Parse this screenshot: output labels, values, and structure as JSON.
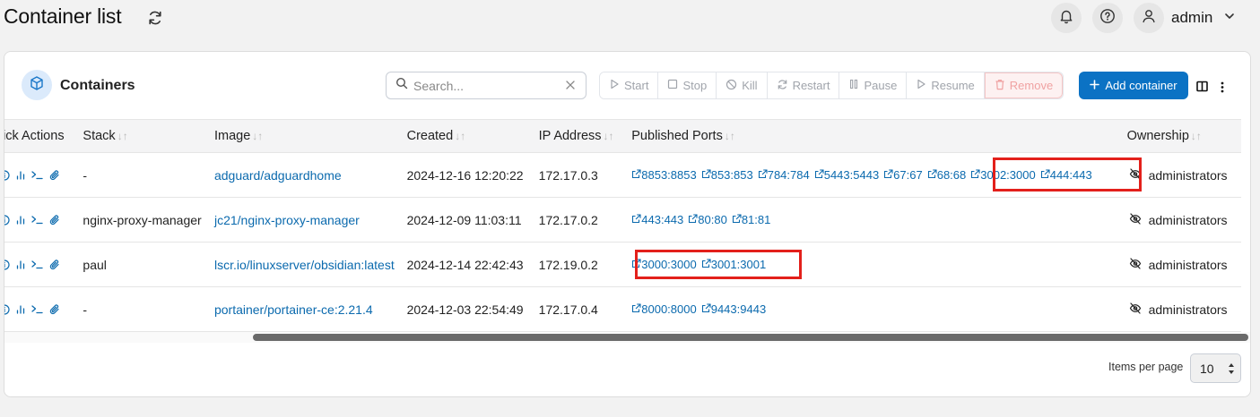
{
  "header": {
    "title": "Container list",
    "user_name": "admin"
  },
  "panel": {
    "title": "Containers",
    "search_placeholder": "Search...",
    "actions": [
      "Start",
      "Stop",
      "Kill",
      "Restart",
      "Pause",
      "Resume",
      "Remove"
    ],
    "add_label": "Add container"
  },
  "table": {
    "columns": [
      "uick Actions",
      "Stack",
      "Image",
      "Created",
      "IP Address",
      "Published Ports",
      "Ownership"
    ],
    "rows": [
      {
        "stack": "-",
        "image": "adguard/adguardhome",
        "created": "2024-12-16 12:20:22",
        "ip": "172.17.0.3",
        "ports": [
          "8853:8853",
          "853:853",
          "784:784",
          "5443:5443",
          "67:67",
          "68:68",
          "3002:3000",
          "444:443"
        ],
        "ownership": "administrators"
      },
      {
        "stack": "nginx-proxy-manager",
        "image": "jc21/nginx-proxy-manager",
        "created": "2024-12-09 11:03:11",
        "ip": "172.17.0.2",
        "ports": [
          "443:443",
          "80:80",
          "81:81"
        ],
        "ownership": "administrators"
      },
      {
        "stack": "paul",
        "image": "lscr.io/linuxserver/obsidian:latest",
        "created": "2024-12-14 22:42:43",
        "ip": "172.19.0.2",
        "ports": [
          "3000:3000",
          "3001:3001"
        ],
        "ownership": "administrators"
      },
      {
        "stack": "-",
        "image": "portainer/portainer-ce:2.21.4",
        "created": "2024-12-03 22:54:49",
        "ip": "172.17.0.4",
        "ports": [
          "8000:8000",
          "9443:9443"
        ],
        "ownership": "administrators"
      }
    ]
  },
  "pagination": {
    "items_per_page_label": "Items per page",
    "items_per_page_value": "10"
  },
  "colors": {
    "accent": "#0b72c4",
    "link": "#0b6aae",
    "highlight": "#e3201b"
  },
  "icons": [
    "refresh-icon",
    "bell-icon",
    "help-icon",
    "user-icon",
    "chevron-down-icon",
    "cube-icon",
    "search-icon",
    "close-icon",
    "play-icon",
    "stop-icon",
    "kill-icon",
    "restart-icon",
    "pause-icon",
    "remove-icon",
    "plus-icon",
    "columns-icon",
    "kebab-icon",
    "info-icon",
    "stats-icon",
    "console-icon",
    "attach-icon",
    "external-link-icon",
    "eye-off-icon"
  ]
}
